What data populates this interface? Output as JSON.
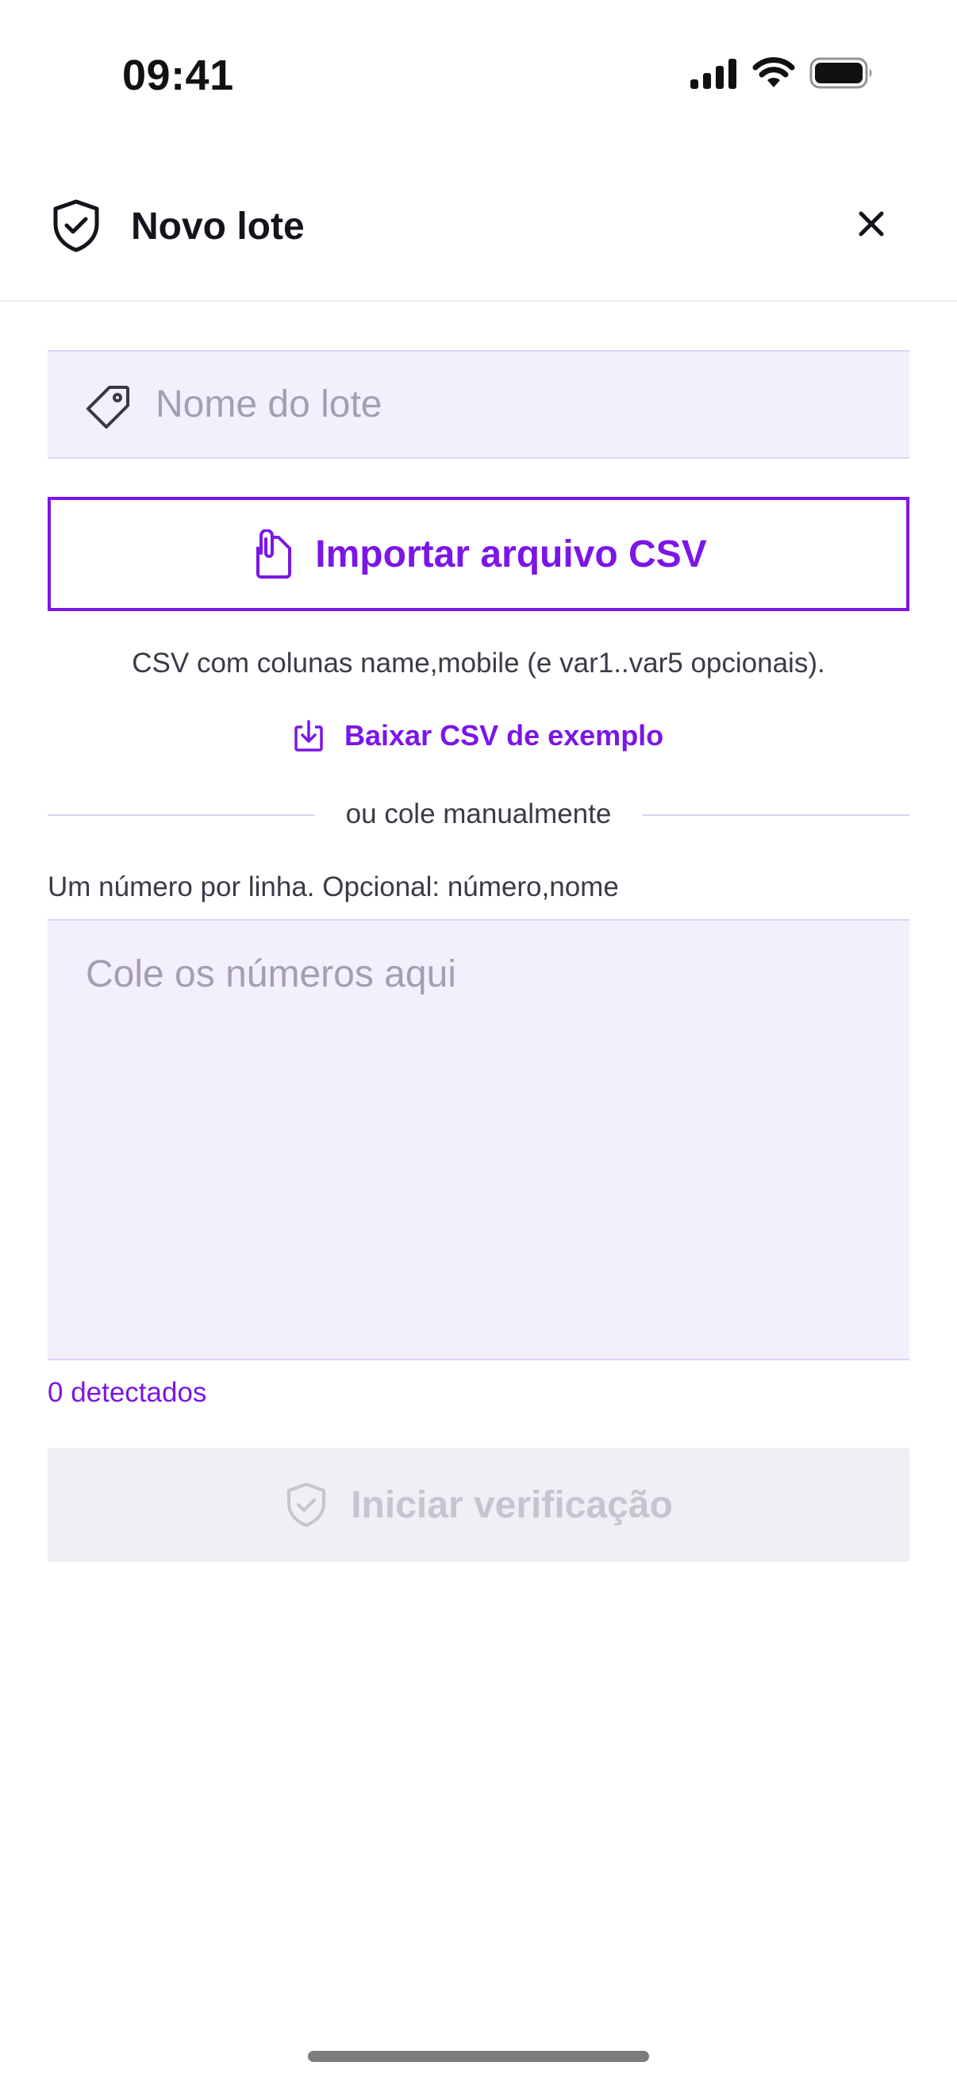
{
  "status_bar": {
    "time": "09:41",
    "icons": [
      "signal-icon",
      "wifi-icon",
      "battery-icon"
    ]
  },
  "header": {
    "title": "Novo lote",
    "icon": "shield-check-icon",
    "close_icon": "close-icon"
  },
  "form": {
    "name_placeholder": "Nome do lote",
    "name_value": "",
    "name_icon": "tag-icon",
    "import_button_label": "Importar arquivo CSV",
    "import_icon": "paperclip-file-icon",
    "csv_help": "CSV com colunas name,mobile (e var1..var5 opcionais).",
    "download_link_label": "Baixar CSV de exemplo",
    "download_icon": "download-icon",
    "divider_label": "ou cole manualmente",
    "paste_hint": "Um número por linha. Opcional: número,nome",
    "paste_placeholder": "Cole os números aqui",
    "paste_value": "",
    "detected_label": "0 detectados",
    "start_button_label": "Iniciar verificação",
    "start_button_enabled": false
  },
  "colors": {
    "accent": "#7b16e6",
    "field_background": "#f4effd",
    "disabled_background": "#f0eff4",
    "disabled_text": "#c7c4d2",
    "muted_text": "#3c3a46",
    "placeholder_text": "#a49eb1"
  }
}
